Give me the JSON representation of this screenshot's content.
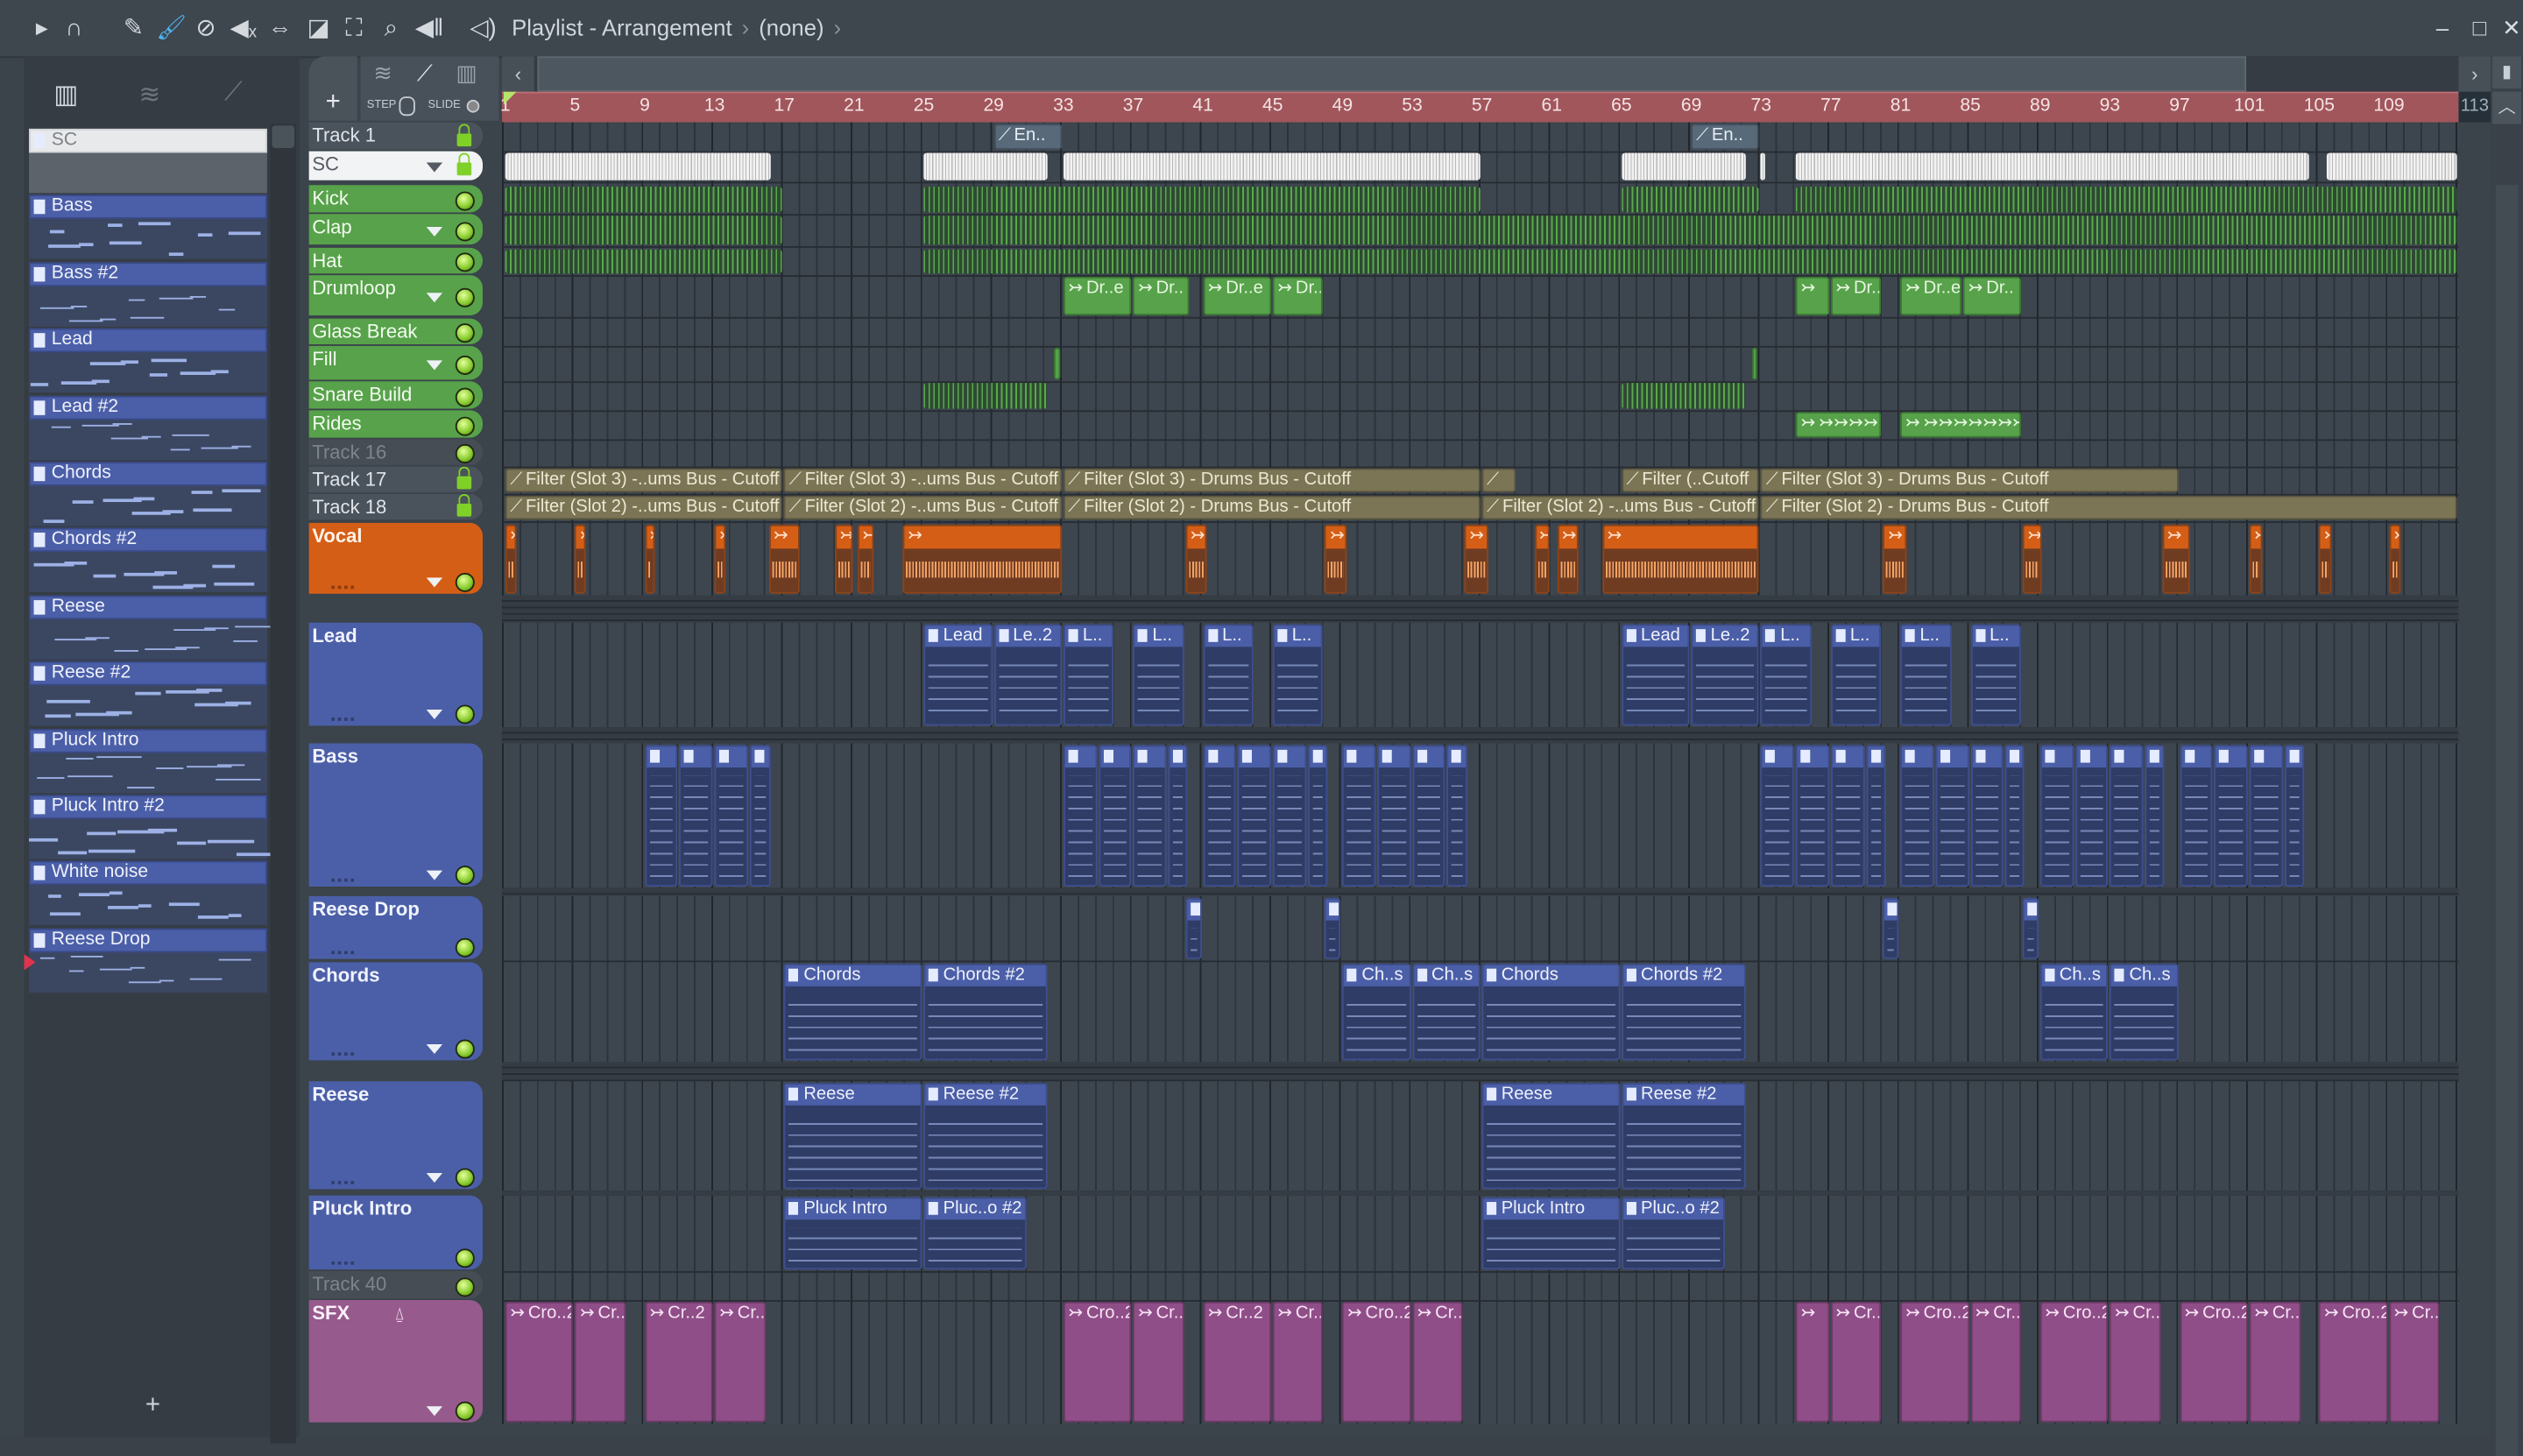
{
  "window": {
    "title": "Playlist - Arrangement",
    "separator": "›",
    "pattern_selector": "(none)",
    "controls": {
      "minimize": "‒",
      "maximize": "□",
      "close": "✕"
    }
  },
  "toolbar": {
    "icons": [
      "play-arrow-icon",
      "magnet-snap-icon",
      "pencil-icon",
      "paint-brush-icon",
      "delete-icon",
      "mute-icon",
      "slip-icon",
      "slice-icon",
      "select-icon",
      "zoom-icon",
      "playback-icon",
      "speaker-icon"
    ],
    "active_tool_color": "#4fb3f0"
  },
  "mode_panel": {
    "step_label": "STEP",
    "slide_label": "SLIDE",
    "add_track": "+"
  },
  "picker": {
    "add_label": "+",
    "patterns": [
      {
        "name": "SC",
        "selected": true
      },
      {
        "name": "Bass"
      },
      {
        "name": "Bass #2"
      },
      {
        "name": "Lead"
      },
      {
        "name": "Lead #2"
      },
      {
        "name": "Chords"
      },
      {
        "name": "Chords #2"
      },
      {
        "name": "Reese"
      },
      {
        "name": "Reese #2"
      },
      {
        "name": "Pluck Intro"
      },
      {
        "name": "Pluck Intro #2"
      },
      {
        "name": "White noise"
      },
      {
        "name": "Reese Drop"
      }
    ]
  },
  "ruler": {
    "bars": [
      "1",
      "5",
      "9",
      "13",
      "17",
      "21",
      "25",
      "29",
      "33",
      "37",
      "41",
      "45",
      "49",
      "53",
      "57",
      "61",
      "65",
      "69",
      "73",
      "77",
      "81",
      "85",
      "89",
      "93",
      "97",
      "101",
      "105",
      "109"
    ],
    "end_bar": "113"
  },
  "colors": {
    "green": "#57a24a",
    "orange": "#d55e16",
    "blue": "#4b5fa8",
    "purple": "#965a8c",
    "ruler": "#a1565b"
  },
  "tracks": [
    {
      "name": "Track 1",
      "style": "gray",
      "status": "lock"
    },
    {
      "name": "SC",
      "style": "white",
      "status": "lock",
      "dropdown": true
    },
    {
      "name": "Kick",
      "style": "green",
      "status": "led"
    },
    {
      "name": "Clap",
      "style": "green",
      "status": "led",
      "dropdown": true
    },
    {
      "name": "Hat",
      "style": "green",
      "status": "led"
    },
    {
      "name": "Drumloop",
      "style": "green",
      "status": "led",
      "dropdown": true
    },
    {
      "name": "Glass Break",
      "style": "green",
      "status": "led"
    },
    {
      "name": "Fill",
      "style": "green",
      "status": "led",
      "dropdown": true
    },
    {
      "name": "Snare Build",
      "style": "green",
      "status": "led"
    },
    {
      "name": "Rides",
      "style": "green",
      "status": "led"
    },
    {
      "name": "Track 16",
      "style": "dim",
      "status": "led"
    },
    {
      "name": "Track 17",
      "style": "gray",
      "status": "lock"
    },
    {
      "name": "Track 18",
      "style": "gray",
      "status": "lock"
    },
    {
      "name": "Vocal",
      "style": "orange",
      "status": "led",
      "dropdown": true
    },
    {
      "name": "Lead",
      "style": "blue",
      "status": "led",
      "dropdown": true
    },
    {
      "name": "Bass",
      "style": "blue",
      "status": "led",
      "dropdown": true
    },
    {
      "name": "Reese Drop",
      "style": "blue",
      "status": "led"
    },
    {
      "name": "Chords",
      "style": "blue",
      "status": "led",
      "dropdown": true
    },
    {
      "name": "Reese",
      "style": "blue",
      "status": "led",
      "dropdown": true
    },
    {
      "name": "Pluck Intro",
      "style": "blue",
      "status": "led"
    },
    {
      "name": "Track 40",
      "style": "dim",
      "status": "led"
    },
    {
      "name": "SFX",
      "style": "purple",
      "status": "led",
      "dropdown": true,
      "extra_icon": "tuning-fork-icon"
    }
  ],
  "clips": [
    {
      "track": 0,
      "kind": "auto2",
      "items": [
        [
          29,
          33,
          "En.."
        ],
        [
          69,
          73,
          "En.."
        ]
      ]
    },
    {
      "track": 1,
      "kind": "sc",
      "items": [
        [
          1,
          16.3,
          ""
        ],
        [
          25,
          32.2,
          ""
        ],
        [
          33,
          57,
          ""
        ],
        [
          65,
          72.2,
          ""
        ],
        [
          73,
          73.3,
          ""
        ],
        [
          75,
          104.5,
          ""
        ],
        [
          105.4,
          113,
          ""
        ]
      ]
    },
    {
      "track": 2,
      "kind": "drum",
      "items": [
        [
          1,
          17,
          ""
        ],
        [
          25,
          57,
          ""
        ],
        [
          65,
          73,
          ""
        ],
        [
          75,
          113,
          ""
        ]
      ]
    },
    {
      "track": 3,
      "kind": "drum",
      "items": [
        [
          1,
          17,
          ""
        ],
        [
          25,
          113,
          ""
        ]
      ]
    },
    {
      "track": 4,
      "kind": "drum",
      "items": [
        [
          1,
          17,
          ""
        ],
        [
          25,
          113,
          ""
        ]
      ]
    },
    {
      "track": 5,
      "kind": "green",
      "items": [
        [
          33,
          37,
          "Dr..e"
        ],
        [
          37,
          40.3,
          "Dr.."
        ],
        [
          41,
          45,
          "Dr..e"
        ],
        [
          45,
          48,
          "Dr.."
        ],
        [
          75,
          77,
          ""
        ],
        [
          77,
          80,
          "Dr.."
        ],
        [
          81,
          84.6,
          "Dr..e"
        ],
        [
          84.6,
          88,
          "Dr.."
        ]
      ]
    },
    {
      "track": 7,
      "kind": "green",
      "items": [
        [
          32.5,
          32.9,
          ""
        ],
        [
          72.5,
          72.9,
          ""
        ]
      ]
    },
    {
      "track": 8,
      "kind": "drum",
      "items": [
        [
          25,
          32.2,
          ""
        ],
        [
          65,
          72.2,
          ""
        ]
      ]
    },
    {
      "track": 9,
      "kind": "green",
      "items": [
        [
          75,
          80,
          "↣↣↣↣↣"
        ],
        [
          81,
          88,
          "↣↣↣↣↣↣↣"
        ]
      ]
    },
    {
      "track": 11,
      "kind": "auto",
      "items": [
        [
          1,
          17,
          "Filter (Slot 3) -..ums Bus - Cutoff"
        ],
        [
          17,
          33,
          "Filter (Slot 3) -..ums Bus - Cutoff"
        ],
        [
          33,
          57,
          "Filter (Slot 3) - Drums Bus - Cutoff"
        ],
        [
          57,
          59,
          ""
        ],
        [
          65,
          73,
          "Filter (..Cutoff"
        ],
        [
          73,
          97,
          "Filter (Slot 3) - Drums Bus - Cutoff"
        ]
      ]
    },
    {
      "track": 12,
      "kind": "auto",
      "items": [
        [
          1,
          17,
          "Filter (Slot 2) -..ums Bus - Cutoff"
        ],
        [
          17,
          33,
          "Filter (Slot 2) -..ums Bus - Cutoff"
        ],
        [
          33,
          57,
          "Filter (Slot 2) - Drums Bus - Cutoff"
        ],
        [
          57,
          73,
          "Filter (Slot 2) -..ums Bus - Cutoff"
        ],
        [
          73,
          113,
          "Filter (Slot 2) - Drums Bus - Cutoff"
        ]
      ]
    },
    {
      "track": 13,
      "kind": "orange",
      "items": [
        [
          1,
          1.7,
          ""
        ],
        [
          5,
          5.7,
          ""
        ],
        [
          9,
          9.7,
          ""
        ],
        [
          13,
          13.7,
          ""
        ],
        [
          16.1,
          18,
          ""
        ],
        [
          19.9,
          21,
          ""
        ],
        [
          21.2,
          22.2,
          ""
        ],
        [
          23.8,
          33,
          ""
        ],
        [
          40,
          41.3,
          ""
        ],
        [
          48,
          49.3,
          ""
        ],
        [
          56,
          57.5,
          ""
        ],
        [
          60,
          61,
          ""
        ],
        [
          61.3,
          62.6,
          ""
        ],
        [
          63.9,
          73,
          ""
        ],
        [
          80,
          81.4,
          ""
        ],
        [
          88,
          89.2,
          ""
        ],
        [
          96,
          97.7,
          ""
        ],
        [
          101,
          101.8,
          ""
        ],
        [
          105,
          105.8,
          ""
        ],
        [
          109,
          109.8,
          ""
        ]
      ]
    },
    {
      "track": 14,
      "kind": "blue",
      "items": [
        [
          25,
          29,
          "Lead"
        ],
        [
          29,
          33,
          "Le..2"
        ],
        [
          33,
          36,
          "L.."
        ],
        [
          37,
          40,
          "L.."
        ],
        [
          41,
          44,
          "L.."
        ],
        [
          45,
          48,
          "L.."
        ],
        [
          65,
          69,
          "Lead"
        ],
        [
          69,
          73,
          "Le..2"
        ],
        [
          73,
          76,
          "L.."
        ],
        [
          77,
          80,
          "L.."
        ],
        [
          81,
          84,
          "L.."
        ],
        [
          85,
          88,
          "L.."
        ]
      ]
    },
    {
      "track": 15,
      "kind": "blue",
      "items": [
        [
          9,
          11,
          ""
        ],
        [
          11,
          13,
          ""
        ],
        [
          13,
          15,
          ""
        ],
        [
          15,
          16.3,
          ""
        ],
        [
          33,
          35,
          ""
        ],
        [
          35,
          37,
          ""
        ],
        [
          37,
          39,
          ""
        ],
        [
          39,
          40.2,
          ""
        ],
        [
          41,
          43,
          ""
        ],
        [
          43,
          45,
          ""
        ],
        [
          45,
          47,
          ""
        ],
        [
          47,
          48.2,
          ""
        ],
        [
          49,
          51,
          ""
        ],
        [
          51,
          53,
          ""
        ],
        [
          53,
          55,
          ""
        ],
        [
          55,
          56.3,
          ""
        ],
        [
          73,
          75,
          ""
        ],
        [
          75,
          77,
          ""
        ],
        [
          77,
          79,
          ""
        ],
        [
          79,
          80.2,
          ""
        ],
        [
          81,
          83,
          ""
        ],
        [
          83,
          85,
          ""
        ],
        [
          85,
          87,
          ""
        ],
        [
          87,
          88.2,
          ""
        ],
        [
          89,
          91,
          ""
        ],
        [
          91,
          93,
          ""
        ],
        [
          93,
          95,
          ""
        ],
        [
          95,
          96.2,
          ""
        ],
        [
          97,
          99,
          ""
        ],
        [
          99,
          101,
          ""
        ],
        [
          101,
          103,
          ""
        ],
        [
          103,
          104.2,
          ""
        ]
      ]
    },
    {
      "track": 16,
      "kind": "blue",
      "items": [
        [
          40,
          41,
          ""
        ],
        [
          48,
          49,
          ""
        ],
        [
          80,
          81,
          ""
        ],
        [
          88,
          89,
          ""
        ]
      ]
    },
    {
      "track": 17,
      "kind": "blue",
      "items": [
        [
          17,
          25,
          "Chords"
        ],
        [
          25,
          32.2,
          "Chords #2"
        ],
        [
          49,
          53,
          "Ch..s"
        ],
        [
          53,
          57,
          "Ch..s"
        ],
        [
          57,
          65,
          "Chords"
        ],
        [
          65,
          72.2,
          "Chords #2"
        ],
        [
          89,
          93,
          "Ch..s"
        ],
        [
          93,
          97,
          "Ch..s"
        ]
      ]
    },
    {
      "track": 18,
      "kind": "blue",
      "items": [
        [
          17,
          25,
          "Reese"
        ],
        [
          25,
          32.2,
          "Reese #2"
        ],
        [
          57,
          65,
          "Reese"
        ],
        [
          65,
          72.2,
          "Reese #2"
        ]
      ]
    },
    {
      "track": 19,
      "kind": "blue",
      "items": [
        [
          17,
          25,
          "Pluck Intro"
        ],
        [
          25,
          31,
          "Pluc..o #2"
        ],
        [
          57,
          65,
          "Pluck Intro"
        ],
        [
          65,
          71,
          "Pluc..o #2"
        ]
      ]
    },
    {
      "track": 21,
      "kind": "purple",
      "items": [
        [
          1,
          5,
          "Cro..2"
        ],
        [
          5,
          8,
          "Cr.."
        ],
        [
          9,
          13,
          "Cr..2"
        ],
        [
          13,
          16,
          "Cr.."
        ],
        [
          33,
          37,
          "Cro..2"
        ],
        [
          37,
          40,
          "Cr.."
        ],
        [
          41,
          45,
          "Cr..2"
        ],
        [
          45,
          48,
          "Cr.."
        ],
        [
          49,
          53,
          "Cro..2"
        ],
        [
          53,
          56,
          "Cr.."
        ],
        [
          75,
          77,
          ""
        ],
        [
          77,
          80,
          "Cr.."
        ],
        [
          81,
          85,
          "Cro..2"
        ],
        [
          85,
          88,
          "Cr.."
        ],
        [
          89,
          93,
          "Cro..2"
        ],
        [
          93,
          96,
          "Cr.."
        ],
        [
          97,
          101,
          "Cro..2"
        ],
        [
          101,
          104,
          "Cr.."
        ],
        [
          105,
          109,
          "Cro..2"
        ],
        [
          109,
          112,
          "Cr.."
        ]
      ]
    }
  ]
}
